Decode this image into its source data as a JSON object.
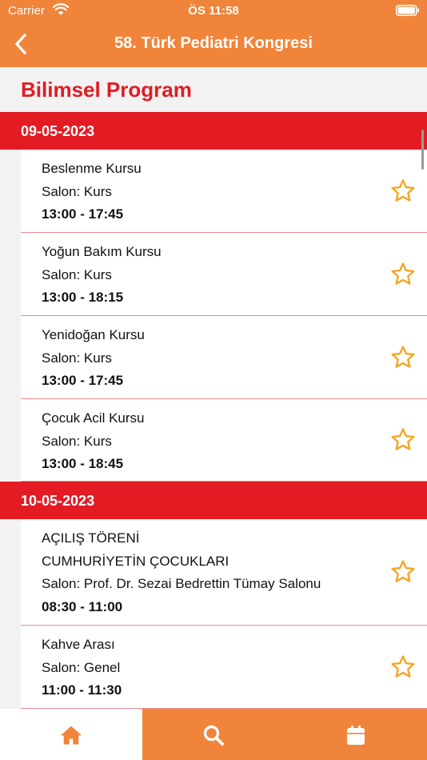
{
  "status_bar": {
    "carrier": "Carrier",
    "time": "ÖS 11:58"
  },
  "nav": {
    "title": "58. Türk Pediatri Kongresi",
    "back_icon": "chevron-left-icon"
  },
  "page": {
    "heading": "Bilimsel Program"
  },
  "days": [
    {
      "date": "09-05-2023",
      "sessions": [
        {
          "lines": [
            "Beslenme Kursu",
            "Salon: Kurs"
          ],
          "time": "13:00 - 17:45"
        },
        {
          "lines": [
            "Yoğun Bakım Kursu",
            "Salon: Kurs"
          ],
          "time": "13:00 - 18:15"
        },
        {
          "lines": [
            "Yenidoğan Kursu",
            "Salon: Kurs"
          ],
          "time": "13:00 - 17:45"
        },
        {
          "lines": [
            "Çocuk Acil Kursu",
            "Salon: Kurs"
          ],
          "time": "13:00 - 18:45"
        }
      ]
    },
    {
      "date": "10-05-2023",
      "sessions": [
        {
          "lines": [
            "AÇILIŞ TÖRENİ",
            "CUMHURİYETİN ÇOCUKLARI",
            "Salon: Prof. Dr. Sezai Bedrettin Tümay Salonu"
          ],
          "time": "08:30 - 11:00"
        },
        {
          "lines": [
            "Kahve Arası",
            "Salon: Genel"
          ],
          "time": "11:00 - 11:30"
        }
      ]
    }
  ],
  "tabbar": {
    "tabs": [
      {
        "icon": "home-icon",
        "active": true
      },
      {
        "icon": "search-icon",
        "active": false
      },
      {
        "icon": "calendar-icon",
        "active": false
      }
    ]
  },
  "colors": {
    "accent": "#f0843a",
    "red": "#e31b23",
    "star": "#f5a623"
  }
}
